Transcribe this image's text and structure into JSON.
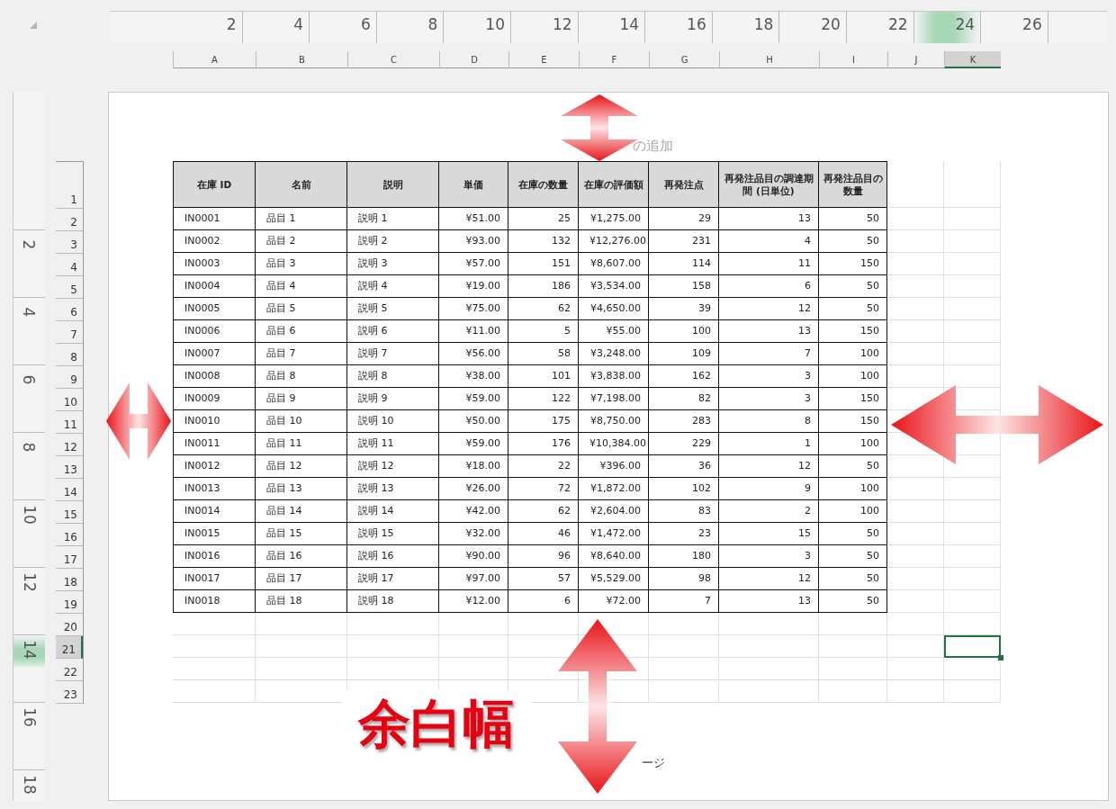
{
  "ruler_top": [
    {
      "label": "2",
      "selected": false
    },
    {
      "label": "4",
      "selected": false
    },
    {
      "label": "6",
      "selected": false
    },
    {
      "label": "8",
      "selected": false
    },
    {
      "label": "10",
      "selected": false
    },
    {
      "label": "12",
      "selected": false
    },
    {
      "label": "14",
      "selected": false
    },
    {
      "label": "16",
      "selected": false
    },
    {
      "label": "18",
      "selected": false
    },
    {
      "label": "20",
      "selected": false
    },
    {
      "label": "22",
      "selected": false
    },
    {
      "label": "24",
      "selected": true
    },
    {
      "label": "26",
      "selected": false
    }
  ],
  "ruler_left": [
    {
      "label": "2",
      "selected": false
    },
    {
      "label": "4",
      "selected": false
    },
    {
      "label": "6",
      "selected": false
    },
    {
      "label": "8",
      "selected": false
    },
    {
      "label": "10",
      "selected": false
    },
    {
      "label": "12",
      "selected": false
    },
    {
      "label": "14",
      "selected": true
    },
    {
      "label": "16",
      "selected": false
    },
    {
      "label": "18",
      "selected": false
    }
  ],
  "column_headers": [
    {
      "label": "A",
      "selected": false
    },
    {
      "label": "B",
      "selected": false
    },
    {
      "label": "C",
      "selected": false
    },
    {
      "label": "D",
      "selected": false
    },
    {
      "label": "E",
      "selected": false
    },
    {
      "label": "F",
      "selected": false
    },
    {
      "label": "G",
      "selected": false
    },
    {
      "label": "H",
      "selected": false
    },
    {
      "label": "I",
      "selected": false
    },
    {
      "label": "J",
      "selected": false
    },
    {
      "label": "K",
      "selected": true
    }
  ],
  "row_headers": [
    {
      "label": "1",
      "selected": false
    },
    {
      "label": "2",
      "selected": false
    },
    {
      "label": "3",
      "selected": false
    },
    {
      "label": "4",
      "selected": false
    },
    {
      "label": "5",
      "selected": false
    },
    {
      "label": "6",
      "selected": false
    },
    {
      "label": "7",
      "selected": false
    },
    {
      "label": "8",
      "selected": false
    },
    {
      "label": "9",
      "selected": false
    },
    {
      "label": "10",
      "selected": false
    },
    {
      "label": "11",
      "selected": false
    },
    {
      "label": "12",
      "selected": false
    },
    {
      "label": "13",
      "selected": false
    },
    {
      "label": "14",
      "selected": false
    },
    {
      "label": "15",
      "selected": false
    },
    {
      "label": "16",
      "selected": false
    },
    {
      "label": "17",
      "selected": false
    },
    {
      "label": "18",
      "selected": false
    },
    {
      "label": "19",
      "selected": false
    },
    {
      "label": "20",
      "selected": false
    },
    {
      "label": "21",
      "selected": true
    },
    {
      "label": "22",
      "selected": false
    },
    {
      "label": "23",
      "selected": false
    }
  ],
  "page_header": "の追加",
  "page_footer": "ージ",
  "table": {
    "columns": [
      "在庫 ID",
      "名前",
      "説明",
      "単価",
      "在庫の数量",
      "在庫の評価額",
      "再発注点",
      "再発注品目の調達期間 (日単位)",
      "再発注品目の数量"
    ],
    "rows": [
      [
        "IN0001",
        "品目 1",
        "説明 1",
        "¥51.00",
        "25",
        "¥1,275.00",
        "29",
        "13",
        "50"
      ],
      [
        "IN0002",
        "品目 2",
        "説明 2",
        "¥93.00",
        "132",
        "¥12,276.00",
        "231",
        "4",
        "50"
      ],
      [
        "IN0003",
        "品目 3",
        "説明 3",
        "¥57.00",
        "151",
        "¥8,607.00",
        "114",
        "11",
        "150"
      ],
      [
        "IN0004",
        "品目 4",
        "説明 4",
        "¥19.00",
        "186",
        "¥3,534.00",
        "158",
        "6",
        "50"
      ],
      [
        "IN0005",
        "品目 5",
        "説明 5",
        "¥75.00",
        "62",
        "¥4,650.00",
        "39",
        "12",
        "50"
      ],
      [
        "IN0006",
        "品目 6",
        "説明 6",
        "¥11.00",
        "5",
        "¥55.00",
        "100",
        "13",
        "150"
      ],
      [
        "IN0007",
        "品目 7",
        "説明 7",
        "¥56.00",
        "58",
        "¥3,248.00",
        "109",
        "7",
        "100"
      ],
      [
        "IN0008",
        "品目 8",
        "説明 8",
        "¥38.00",
        "101",
        "¥3,838.00",
        "162",
        "3",
        "100"
      ],
      [
        "IN0009",
        "品目 9",
        "説明 9",
        "¥59.00",
        "122",
        "¥7,198.00",
        "82",
        "3",
        "150"
      ],
      [
        "IN0010",
        "品目 10",
        "説明 10",
        "¥50.00",
        "175",
        "¥8,750.00",
        "283",
        "8",
        "150"
      ],
      [
        "IN0011",
        "品目 11",
        "説明 11",
        "¥59.00",
        "176",
        "¥10,384.00",
        "229",
        "1",
        "100"
      ],
      [
        "IN0012",
        "品目 12",
        "説明 12",
        "¥18.00",
        "22",
        "¥396.00",
        "36",
        "12",
        "50"
      ],
      [
        "IN0013",
        "品目 13",
        "説明 13",
        "¥26.00",
        "72",
        "¥1,872.00",
        "102",
        "9",
        "100"
      ],
      [
        "IN0014",
        "品目 14",
        "説明 14",
        "¥42.00",
        "62",
        "¥2,604.00",
        "83",
        "2",
        "100"
      ],
      [
        "IN0015",
        "品目 15",
        "説明 15",
        "¥32.00",
        "46",
        "¥1,472.00",
        "23",
        "15",
        "50"
      ],
      [
        "IN0016",
        "品目 16",
        "説明 16",
        "¥90.00",
        "96",
        "¥8,640.00",
        "180",
        "3",
        "50"
      ],
      [
        "IN0017",
        "品目 17",
        "説明 17",
        "¥97.00",
        "57",
        "¥5,529.00",
        "98",
        "12",
        "50"
      ],
      [
        "IN0018",
        "品目 18",
        "説明 18",
        "¥12.00",
        "6",
        "¥72.00",
        "7",
        "13",
        "50"
      ]
    ]
  },
  "annotation": "余白幅"
}
